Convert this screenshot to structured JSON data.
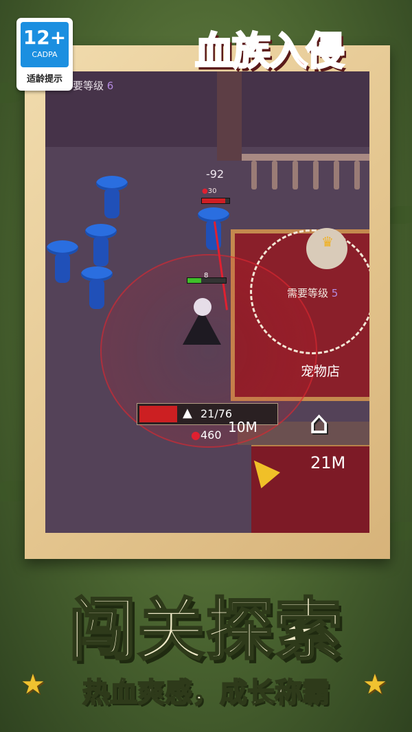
{
  "rating_badge": {
    "age": "12+",
    "org": "CADPA",
    "label": "适龄提示"
  },
  "game_title": "血族入侵",
  "hud": {
    "level_req_top": {
      "prefix": "要等级",
      "level": "6"
    },
    "damage_popup": "-92",
    "enemy_gem_count": "30",
    "enemy_hp_fraction": 0.85,
    "player_level": "8",
    "player_hp_fraction": 0.35,
    "level_req_shop": {
      "prefix": "需要等级",
      "level": "5"
    },
    "shop_label": "宠物店",
    "capacity": "21/76",
    "capacity_fraction": 0.276,
    "gems": "460",
    "distance_near": "10M",
    "distance_home": "21M"
  },
  "banner": {
    "headline": "闯关探索",
    "tagline": "热血爽感，成长称霸"
  },
  "icons": [
    "home-icon",
    "weight-icon",
    "gem-icon",
    "arrow-pointer-icon",
    "star-icon"
  ],
  "colors": {
    "title_red": "#e8332c",
    "headline_cream": "#efe9c8",
    "hp_red": "#cc1f22",
    "xp_green": "#3fbf2a",
    "enemy_blue": "#2a6ee0"
  }
}
